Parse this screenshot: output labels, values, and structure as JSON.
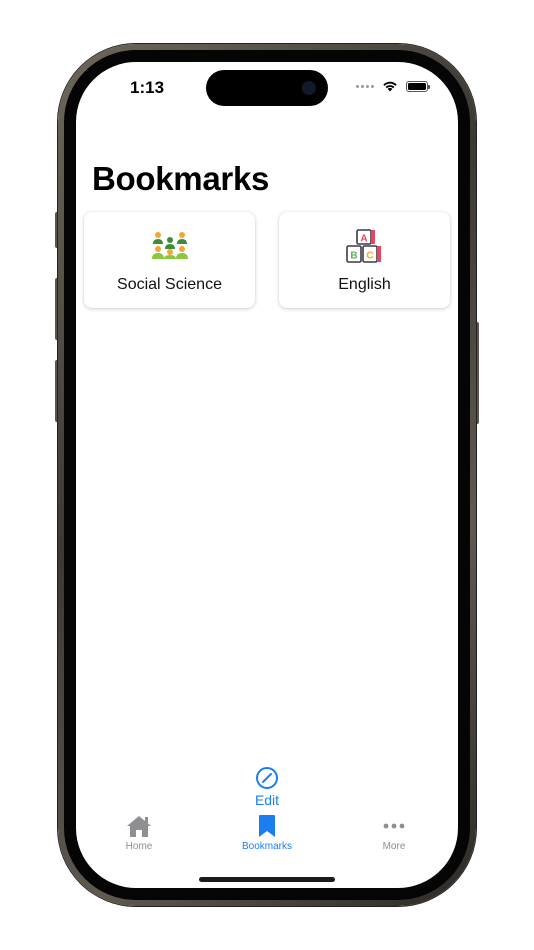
{
  "status_bar": {
    "time": "1:13"
  },
  "page": {
    "title": "Bookmarks"
  },
  "bookmarks": [
    {
      "label": "Social Science",
      "icon": "people-group-icon"
    },
    {
      "label": "English",
      "icon": "abc-blocks-icon"
    }
  ],
  "edit": {
    "label": "Edit",
    "icon": "edit-pencil-circle-icon"
  },
  "tabs": [
    {
      "label": "Home",
      "icon": "house-icon",
      "active": false
    },
    {
      "label": "Bookmarks",
      "icon": "bookmark-icon",
      "active": true
    },
    {
      "label": "More",
      "icon": "ellipsis-icon",
      "active": false
    }
  ],
  "colors": {
    "accent": "#1a7df0",
    "inactive_tab": "#8e8e93",
    "people_orange": "#f0a830",
    "people_green": "#3d8c3a",
    "people_lightgreen": "#8cc63f",
    "block_red": "#e8455f",
    "block_dark": "#3a3a4a"
  }
}
